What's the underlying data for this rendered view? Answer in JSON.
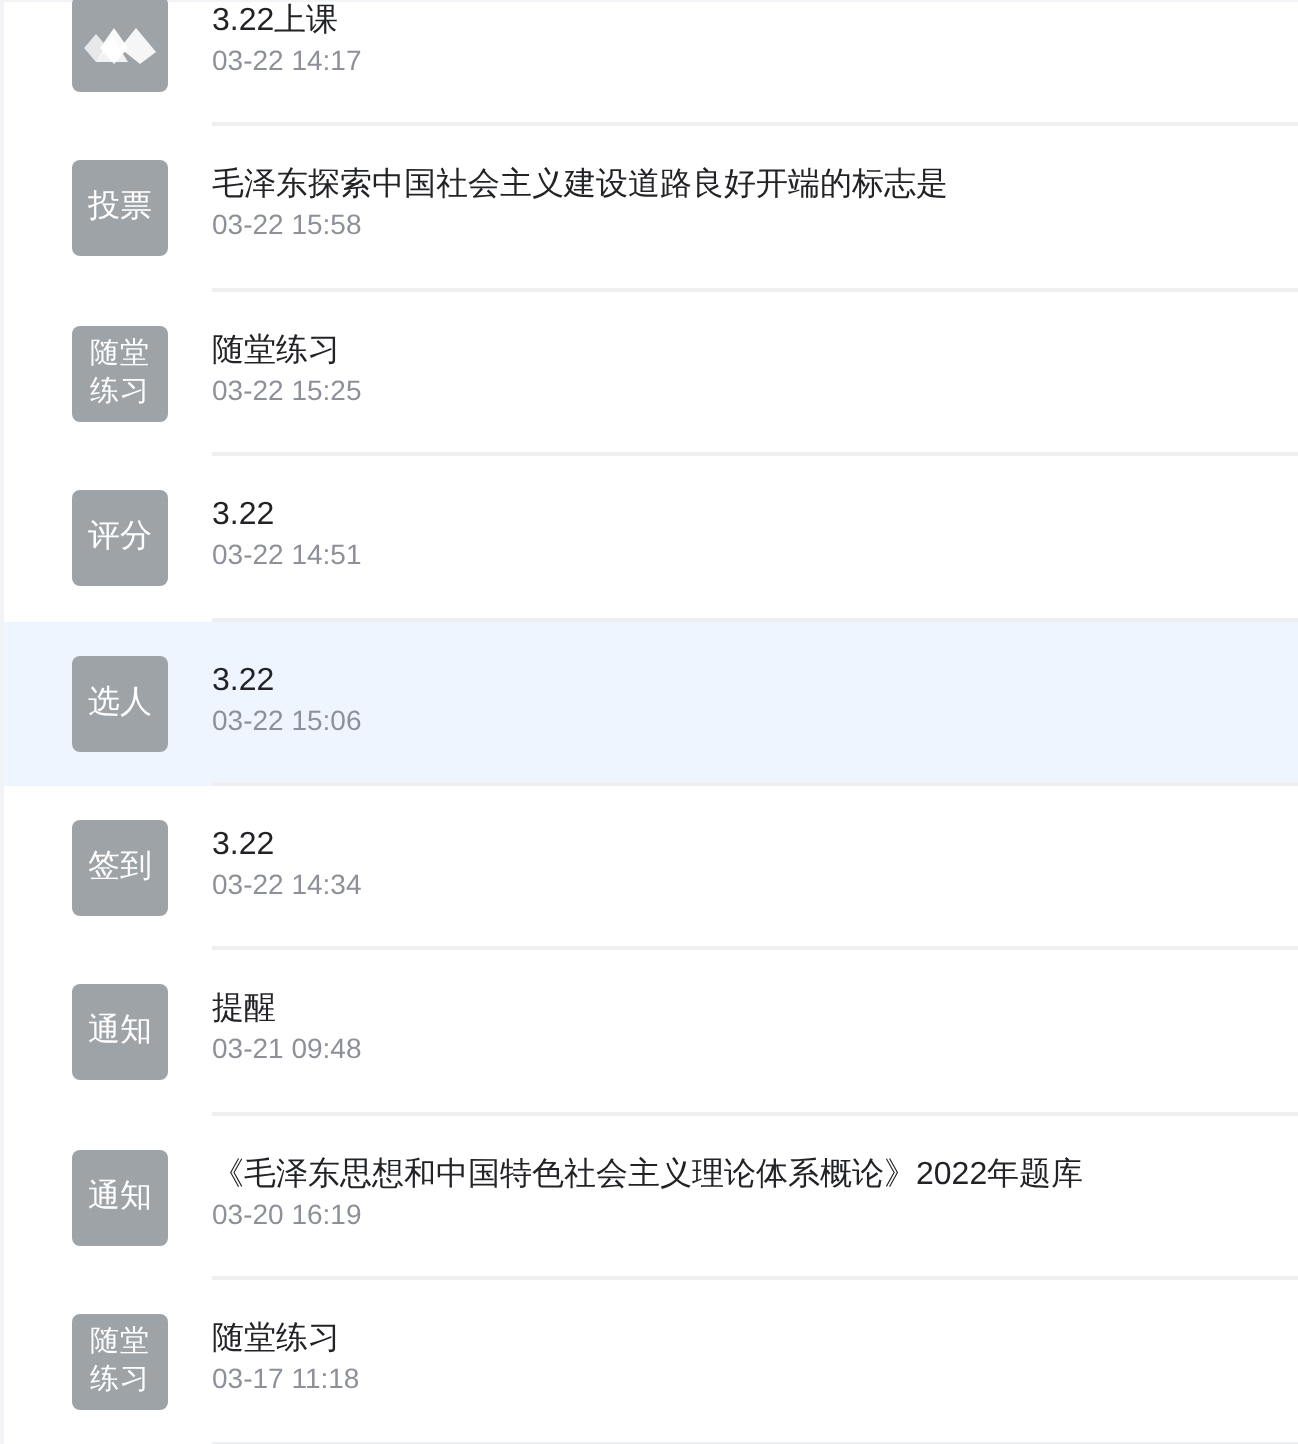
{
  "items": [
    {
      "kind": "logo",
      "title": "3.22上课",
      "time": "03-22 14:17",
      "selected": false
    },
    {
      "kind": "label",
      "badge": "投票",
      "title": "毛泽东探索中国社会主义建设道路良好开端的标志是",
      "time": "03-22 15:58",
      "selected": false
    },
    {
      "kind": "label",
      "badge": "随堂练习",
      "title": "随堂练习",
      "time": "03-22 15:25",
      "selected": false
    },
    {
      "kind": "label",
      "badge": "评分",
      "title": "3.22",
      "time": "03-22 14:51",
      "selected": false
    },
    {
      "kind": "label",
      "badge": "选人",
      "title": "3.22",
      "time": "03-22 15:06",
      "selected": true
    },
    {
      "kind": "label",
      "badge": "签到",
      "title": "3.22",
      "time": "03-22 14:34",
      "selected": false
    },
    {
      "kind": "label",
      "badge": "通知",
      "title": "提醒",
      "time": "03-21 09:48",
      "selected": false
    },
    {
      "kind": "label",
      "badge": "通知",
      "title": "《毛泽东思想和中国特色社会主义理论体系概论》2022年题库",
      "time": "03-20 16:19",
      "selected": false
    },
    {
      "kind": "label",
      "badge": "随堂练习",
      "title": "随堂练习",
      "time": "03-17 11:18",
      "selected": false
    }
  ]
}
